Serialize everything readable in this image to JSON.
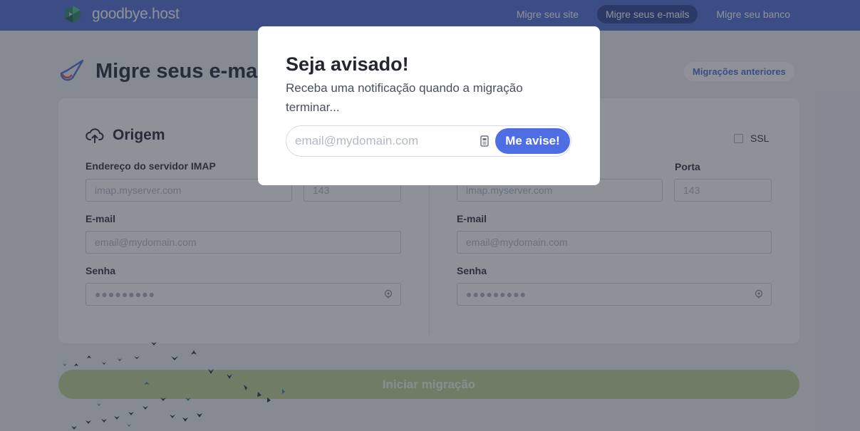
{
  "header": {
    "brand": "goodbye.host",
    "nav": [
      {
        "label": "Migre seu site",
        "active": false
      },
      {
        "label": "Migre seus e-mails",
        "active": true
      },
      {
        "label": "Migre seu banco",
        "active": false
      }
    ]
  },
  "page": {
    "title": "Migre seus e-mail",
    "previous_migrations_label": "Migrações anteriores"
  },
  "source": {
    "title": "Origem",
    "imap_label": "Endereço do servidor IMAP",
    "imap_placeholder": "imap.myserver.com",
    "port_placeholder": "143",
    "email_label": "E-mail",
    "email_placeholder": "email@mydomain.com",
    "password_label": "Senha",
    "password_value": "●●●●●●●●●"
  },
  "destination": {
    "ssl_label": "SSL",
    "port_label": "Porta",
    "imap_placeholder": "imap.myserver.com",
    "port_placeholder": "143",
    "email_label": "E-mail",
    "email_placeholder": "email@mydomain.com",
    "password_label": "Senha",
    "password_value": "●●●●●●●●●"
  },
  "start_button_label": "Iniciar migração",
  "modal": {
    "title": "Seja avisado!",
    "text": "Receba uma notificação quando a migração terminar...",
    "input_placeholder": "email@mydomain.com",
    "button_label": "Me avise!"
  },
  "colors": {
    "brand": "#5b76d8",
    "nav_active": "#3a4f9e",
    "start_button": "#c5d59a",
    "notify_button": "#4f6ee4"
  }
}
